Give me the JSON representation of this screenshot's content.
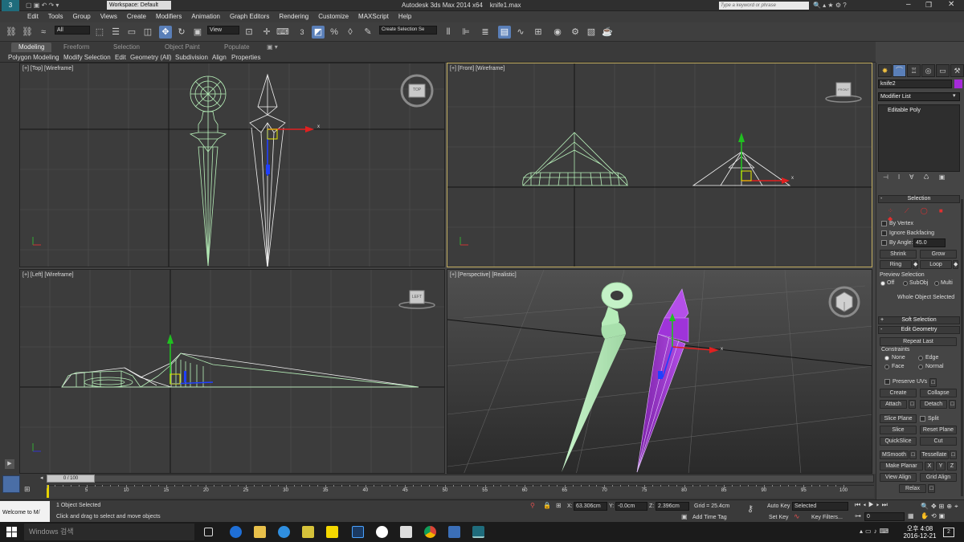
{
  "window": {
    "workspace_label": "Workspace: Default",
    "app_title": "Autodesk 3ds Max  2014 x64",
    "file_name": "knife1.max",
    "search_placeholder": "Type a keyword or phrase"
  },
  "menu": [
    "Edit",
    "Tools",
    "Group",
    "Views",
    "Create",
    "Modifiers",
    "Animation",
    "Graph Editors",
    "Rendering",
    "Customize",
    "MAXScript",
    "Help"
  ],
  "toolbar": {
    "filter_value": "All",
    "refcoord_value": "View",
    "named_selection_value": "Create Selection Se",
    "snap_label": "3"
  },
  "ribbon": {
    "tabs": [
      "Modeling",
      "Freeform",
      "Selection",
      "Object Paint",
      "Populate"
    ],
    "items": [
      "Polygon Modeling",
      "Modify Selection",
      "Edit",
      "Geometry (All)",
      "Subdivision",
      "Align",
      "Properties"
    ]
  },
  "viewports": {
    "top": {
      "label": "[+] [Top] [Wireframe]",
      "cube": "TOP"
    },
    "front": {
      "label": "[+] [Front] [Wireframe]",
      "cube": "FRONT"
    },
    "left": {
      "label": "[+] [Left] [Wireframe]",
      "cube": "LEFT"
    },
    "persp": {
      "label": "[+] [Perspective] [Realistic]"
    }
  },
  "command_panel": {
    "object_name": "knife2",
    "modifier_list": "Modifier List",
    "stack_item": "Editable Poly",
    "selection": {
      "title": "Selection",
      "by_vertex": "By Vertex",
      "ignore_backfacing": "Ignore Backfacing",
      "by_angle": "By Angle:",
      "angle_value": "45.0",
      "shrink": "Shrink",
      "grow": "Grow",
      "ring": "Ring",
      "loop": "Loop",
      "preview_title": "Preview Selection",
      "off": "Off",
      "subobj": "SubObj",
      "multi": "Multi",
      "whole_object": "Whole Object Selected"
    },
    "soft_selection": "Soft Selection",
    "edit_geometry": {
      "title": "Edit Geometry",
      "repeat_last": "Repeat Last",
      "constraints": "Constraints",
      "none": "None",
      "edge": "Edge",
      "face": "Face",
      "normal": "Normal",
      "preserve_uvs": "Preserve UVs",
      "create": "Create",
      "collapse": "Collapse",
      "attach": "Attach",
      "detach": "Detach",
      "slice_plane": "Slice Plane",
      "split": "Split",
      "slice": "Slice",
      "reset_plane": "Reset Plane",
      "quickslice": "QuickSlice",
      "cut": "Cut",
      "msmooth": "MSmooth",
      "tessellate": "Tessellate",
      "make_planar": "Make Planar",
      "x": "X",
      "y": "Y",
      "z": "Z",
      "view_align": "View Align",
      "grid_align": "Grid Align",
      "relax": "Relax"
    }
  },
  "timeline": {
    "frame_label": "0 / 100",
    "ticks": [
      "5",
      "10",
      "15",
      "20",
      "25",
      "30",
      "35",
      "40",
      "45",
      "50",
      "55",
      "60",
      "65",
      "70",
      "75",
      "80",
      "85",
      "90",
      "95",
      "100"
    ]
  },
  "status": {
    "maxscript_listener": "Welcome to M/",
    "selected": "1 Object Selected",
    "prompt": "Click and drag to select and move objects",
    "x_label": "X:",
    "x_value": "63.306cm",
    "y_label": "Y:",
    "y_value": "-0.0cm",
    "z_label": "Z:",
    "z_value": "2.396cm",
    "grid": "Grid = 25.4cm",
    "auto_key": "Auto Key",
    "set_key": "Set Key",
    "selected_dropdown": "Selected",
    "key_filters": "Key Filters...",
    "add_time_tag": "Add Time Tag",
    "frame_value": "0"
  },
  "taskbar": {
    "search": "Windows 검색",
    "time": "오후 4:08",
    "date": "2016-12-21",
    "notif": "2"
  },
  "colors": {
    "knife1": "#b7f0b9",
    "knife2": "#a62ad9",
    "active_border": "#c2ad60",
    "grid": "#505050"
  }
}
